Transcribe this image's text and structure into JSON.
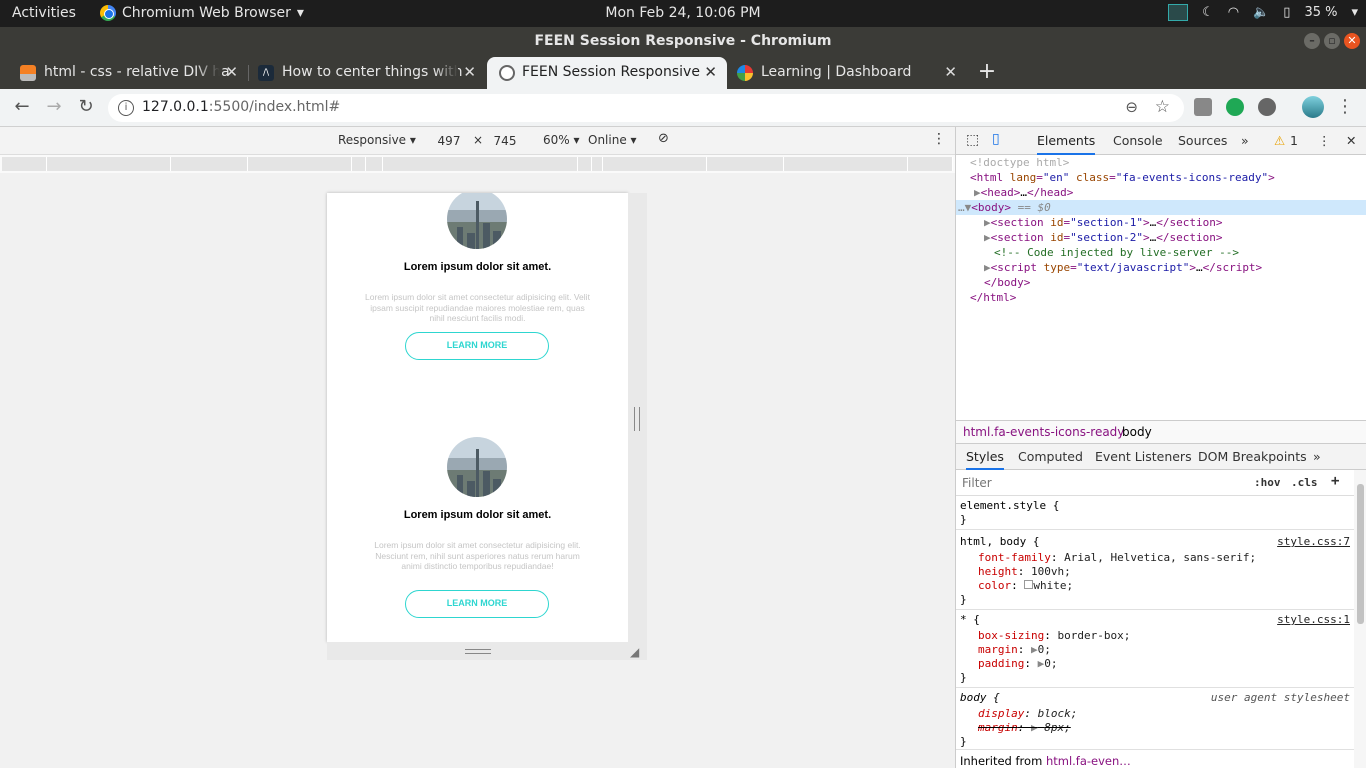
{
  "topbar": {
    "activities": "Activities",
    "app_name": "Chromium Web Browser",
    "clock": "Mon Feb 24, 10:06 PM",
    "battery": "35 %"
  },
  "window": {
    "title": "FEEN Session Responsive - Chromium"
  },
  "tabs": [
    {
      "label": "html - css - relative DIV ha",
      "icon": "stackoverflow-icon"
    },
    {
      "label": "How to center things with",
      "icon": "site-favicon"
    },
    {
      "label": "FEEN Session Responsive",
      "icon": "globe-icon",
      "active": true
    },
    {
      "label": "Learning | Dashboard",
      "icon": "colorful-favicon"
    }
  ],
  "address": {
    "host": "127.0.0.1",
    "rest": ":5500/index.html#"
  },
  "device_toolbar": {
    "device": "Responsive",
    "width": "497",
    "times": "×",
    "height": "745",
    "zoom": "60%",
    "network": "Online"
  },
  "page": {
    "cards": [
      {
        "title": "Lorem ipsum dolor sit amet.",
        "text": "Lorem ipsum dolor sit amet consectetur adipisicing elit. Velit ipsam suscipit repudiandae maiores molestiae rem, quas nihil nesciunt facilis modi.",
        "button": "LEARN MORE"
      },
      {
        "title": "Lorem ipsum dolor sit amet.",
        "text": "Lorem ipsum dolor sit amet consectetur adipisicing elit. Nesciunt rem, nihil sunt asperiores natus rerum harum animi distinctio temporibus repudiandae!",
        "button": "LEARN MORE"
      }
    ],
    "accent_color": "#2ed6d0"
  },
  "devtools": {
    "tabs": [
      "Elements",
      "Console",
      "Sources"
    ],
    "more": "»",
    "warnings": "1",
    "dom": {
      "doctype": "<!doctype html>",
      "html_open_tag": "html",
      "lang_attr": "lang",
      "lang_val": "\"en\"",
      "class_attr": "class",
      "class_val": "\"fa-events-icons-ready\"",
      "head": "head",
      "body": "body",
      "selected_marker": "== $0",
      "section_attr": "id",
      "section1": "\"section-1\"",
      "section2": "\"section-2\"",
      "comment": "<!-- Code injected by live-server -->",
      "script_attr": "type",
      "script_type": "\"text/javascript\"",
      "ellipsis": "…"
    },
    "breadcrumbs": [
      "html.fa-events-icons-ready",
      "body"
    ],
    "style_tabs": [
      "Styles",
      "Computed",
      "Event Listeners",
      "DOM Breakpoints"
    ],
    "filter_placeholder": "Filter",
    "hov": ":hov",
    "cls": ".cls",
    "rules": {
      "element_style": "element.style {",
      "r1_selector": "html, body {",
      "r1_source": "style.css:7",
      "r1_props": [
        {
          "name": "font-family",
          "value": "Arial, Helvetica, sans-serif;"
        },
        {
          "name": "height",
          "value": "100vh;"
        },
        {
          "name": "color",
          "value": "white;"
        }
      ],
      "r2_selector": "* {",
      "r2_source": "style.css:1",
      "r2_props": [
        {
          "name": "box-sizing",
          "value": "border-box;"
        },
        {
          "name": "margin",
          "value": "0;"
        },
        {
          "name": "padding",
          "value": "0;"
        }
      ],
      "r3_selector": "body {",
      "r3_source": "user agent stylesheet",
      "r3_props": [
        {
          "name": "display",
          "value": "block;"
        },
        {
          "name": "margin",
          "value": "8px;"
        }
      ],
      "inherited_label": "Inherited from",
      "inherited_from": "html.fa-even…",
      "close_brace": "}"
    }
  }
}
